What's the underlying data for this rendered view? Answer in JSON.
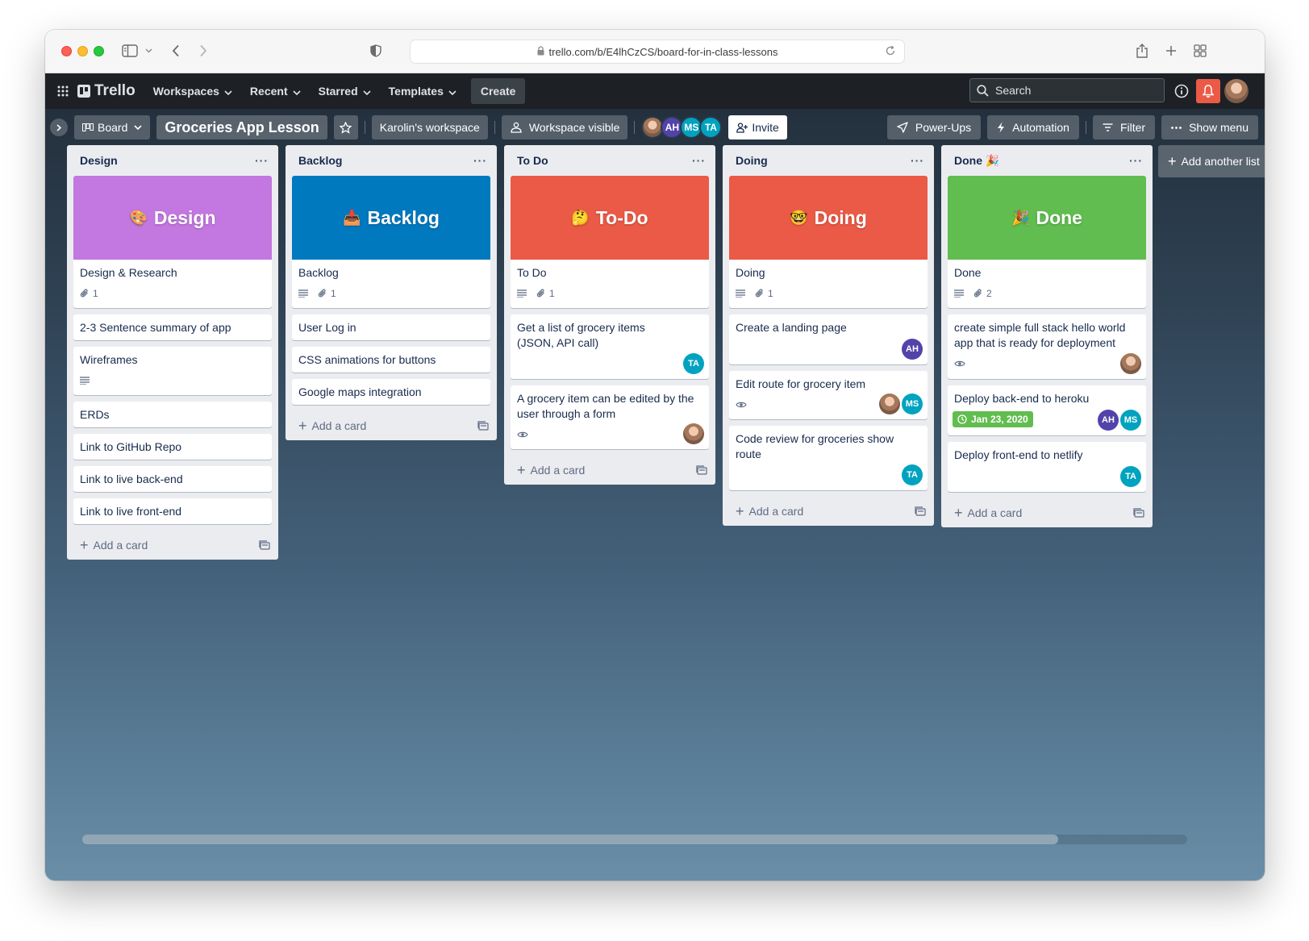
{
  "browser": {
    "url": "trello.com/b/E4lhCzCS/board-for-in-class-lessons"
  },
  "header": {
    "logo": "Trello",
    "nav": [
      "Workspaces",
      "Recent",
      "Starred",
      "Templates"
    ],
    "create": "Create",
    "search_placeholder": "Search"
  },
  "board_bar": {
    "view": "Board",
    "title": "Groceries App Lesson",
    "workspace": "Karolin's workspace",
    "visibility": "Workspace visible",
    "members": [
      "AH",
      "MS",
      "TA"
    ],
    "invite": "Invite",
    "power_ups": "Power-Ups",
    "automation": "Automation",
    "filter": "Filter",
    "show_menu": "Show menu",
    "add_another": "Add another list"
  },
  "lists": [
    {
      "title": "Design",
      "cover": {
        "emoji": "🎨",
        "text": "Design",
        "color": "#c377e0"
      },
      "cover_card": {
        "title": "Design & Research",
        "attachments": "1"
      },
      "cards": [
        "2-3 Sentence summary of app",
        "Wireframes",
        "ERDs",
        "Link to GitHub Repo",
        "Link to live back-end",
        "Link to live front-end"
      ],
      "add_card": "Add a card"
    },
    {
      "title": "Backlog",
      "cover": {
        "emoji": "📥",
        "text": "Backlog",
        "color": "#0079bf"
      },
      "cover_card": {
        "title": "Backlog",
        "attachments": "1"
      },
      "cards": [
        "User Log in",
        "CSS animations for buttons",
        "Google maps integration"
      ],
      "add_card": "Add a card"
    },
    {
      "title": "To Do",
      "cover": {
        "emoji": "🤔",
        "text": "To-Do",
        "color": "#eb5a46"
      },
      "cover_card": {
        "title": "To Do",
        "attachments": "1"
      },
      "cards": [
        {
          "title": "Get a list of grocery items (JSON, API call)",
          "members": [
            "TA"
          ]
        },
        {
          "title": "A grocery item can be edited by the user through a form"
        }
      ],
      "add_card": "Add a card"
    },
    {
      "title": "Doing",
      "cover": {
        "emoji": "🤓",
        "text": "Doing",
        "color": "#eb5a46"
      },
      "cover_card": {
        "title": "Doing",
        "attachments": "1"
      },
      "cards": [
        {
          "title": "Create a landing page",
          "members": [
            "AH"
          ]
        },
        {
          "title": "Edit route for grocery item",
          "members": [
            "MS"
          ]
        },
        {
          "title": "Code review for groceries show route",
          "members": [
            "TA"
          ]
        }
      ],
      "add_card": "Add a card"
    },
    {
      "title": "Done 🎉",
      "cover": {
        "emoji": "🎉",
        "text": "Done",
        "color": "#61bd4f"
      },
      "cover_card": {
        "title": "Done",
        "attachments": "2"
      },
      "cards": [
        {
          "title": "create simple full stack hello world app that is ready for deployment"
        },
        {
          "title": "Deploy back-end to heroku",
          "due": "Jan 23, 2020",
          "members": [
            "AH",
            "MS"
          ]
        },
        {
          "title": "Deploy front-end to netlify",
          "members": [
            "TA"
          ]
        }
      ],
      "add_card": "Add a card"
    }
  ],
  "colors": {
    "header_bg": "#1d2125",
    "list_bg": "#ebecf0",
    "notification": "#eb5a46",
    "done_badge": "#61bd4f"
  }
}
